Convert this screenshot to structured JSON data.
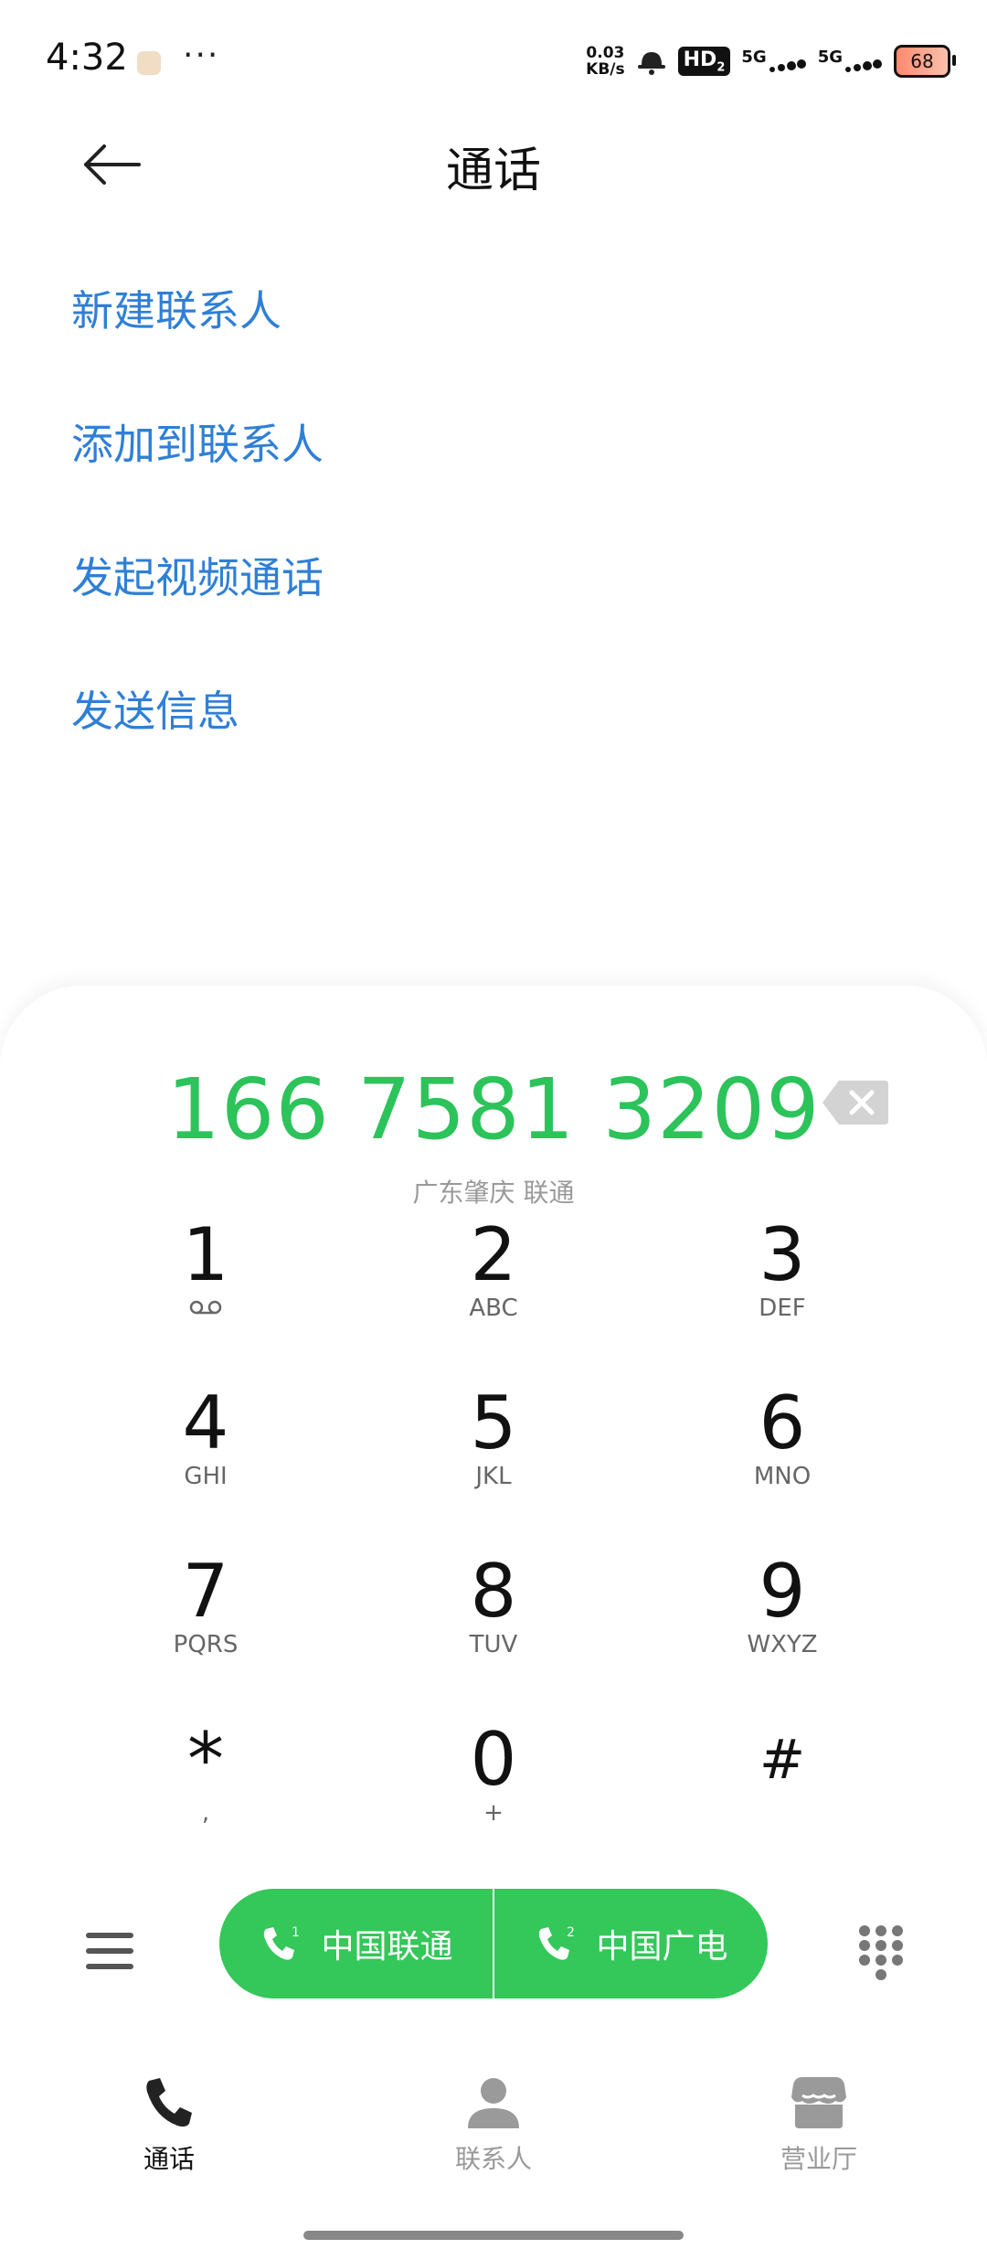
{
  "status_bar": {
    "time": "4:32",
    "more": "···",
    "speed_value": "0.03",
    "speed_unit": "KB/s",
    "hd": "HD",
    "hd_sub": "2",
    "net1": "5G",
    "net2": "5G",
    "battery": "68"
  },
  "header": {
    "title": "通话"
  },
  "options": [
    "新建联系人",
    "添加到联系人",
    "发起视频通话",
    "发送信息"
  ],
  "dialer": {
    "number": "166 7581 3209",
    "location": "广东肇庆 联通",
    "keys": [
      {
        "digit": "1",
        "letters": ""
      },
      {
        "digit": "2",
        "letters": "ABC"
      },
      {
        "digit": "3",
        "letters": "DEF"
      },
      {
        "digit": "4",
        "letters": "GHI"
      },
      {
        "digit": "5",
        "letters": "JKL"
      },
      {
        "digit": "6",
        "letters": "MNO"
      },
      {
        "digit": "7",
        "letters": "PQRS"
      },
      {
        "digit": "8",
        "letters": "TUV"
      },
      {
        "digit": "9",
        "letters": "WXYZ"
      },
      {
        "digit": "*",
        "letters": ","
      },
      {
        "digit": "0",
        "letters": "+"
      },
      {
        "digit": "#",
        "letters": ""
      }
    ],
    "sim1": {
      "label": "中国联通",
      "slot": "1"
    },
    "sim2": {
      "label": "中国广电",
      "slot": "2"
    }
  },
  "tabs": [
    {
      "label": "通话",
      "icon": "phone-icon",
      "active": true
    },
    {
      "label": "联系人",
      "icon": "person-icon",
      "active": false
    },
    {
      "label": "营业厅",
      "icon": "store-icon",
      "active": false
    }
  ],
  "colors": {
    "accent_green": "#34c759",
    "number_green": "#2cc35a",
    "link_blue": "#2f7fd6"
  }
}
